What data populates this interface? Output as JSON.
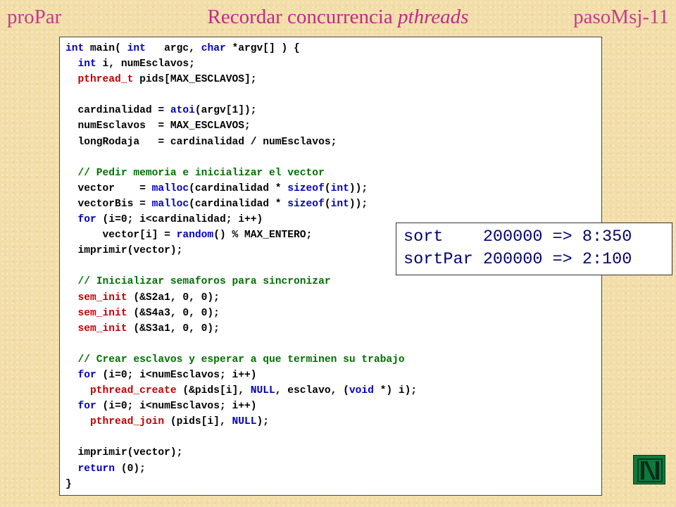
{
  "header": {
    "left": "proPar",
    "title_plain": "Recordar concurrencia ",
    "title_italic": "pthreads",
    "right": "pasoMsj-11"
  },
  "code": {
    "l01": "int main( int   argc, char *argv[] ) {",
    "l02": "  int i, numEsclavos;",
    "l03": "  pthread_t pids[MAX_ESCLAVOS];",
    "l04": "",
    "l05": "  cardinalidad = atoi(argv[1]);",
    "l06": "  numEsclavos  = MAX_ESCLAVOS;",
    "l07": "  longRodaja   = cardinalidad / numEsclavos;",
    "l08": "",
    "l09": "  // Pedir memoria e inicializar el vector",
    "l10": "  vector    = malloc(cardinalidad * sizeof(int));",
    "l11": "  vectorBis = malloc(cardinalidad * sizeof(int));",
    "l12": "  for (i=0; i<cardinalidad; i++)",
    "l13": "      vector[i] = random() % MAX_ENTERO;",
    "l14": "  imprimir(vector);",
    "l15": "",
    "l16": "  // Inicializar semaforos para sincronizar",
    "l17": "  sem_init (&S2a1, 0, 0);",
    "l18": "  sem_init (&S4a3, 0, 0);",
    "l19": "  sem_init (&S3a1, 0, 0);",
    "l20": "",
    "l21": "  // Crear esclavos y esperar a que terminen su trabajo",
    "l22": "  for (i=0; i<numEsclavos; i++)",
    "l23": "    pthread_create (&pids[i], NULL, esclavo, (void *) i);",
    "l24": "  for (i=0; i<numEsclavos; i++)",
    "l25": "    pthread_join (pids[i], NULL);",
    "l26": "",
    "l27": "  imprimir(vector);",
    "l28": "  return (0);",
    "l29": "}"
  },
  "overlay": {
    "line1": "sort    200000 => 8:350",
    "line2": "sortPar 200000 => 2:100"
  },
  "nav_icon": "navigation-bars-icon",
  "colors": {
    "header": "#c73a8f",
    "keyword": "#0000c0",
    "type": "#c00000",
    "comment": "#007000",
    "overlay_text": "#000070",
    "nav_button": "#0d7a3e"
  }
}
